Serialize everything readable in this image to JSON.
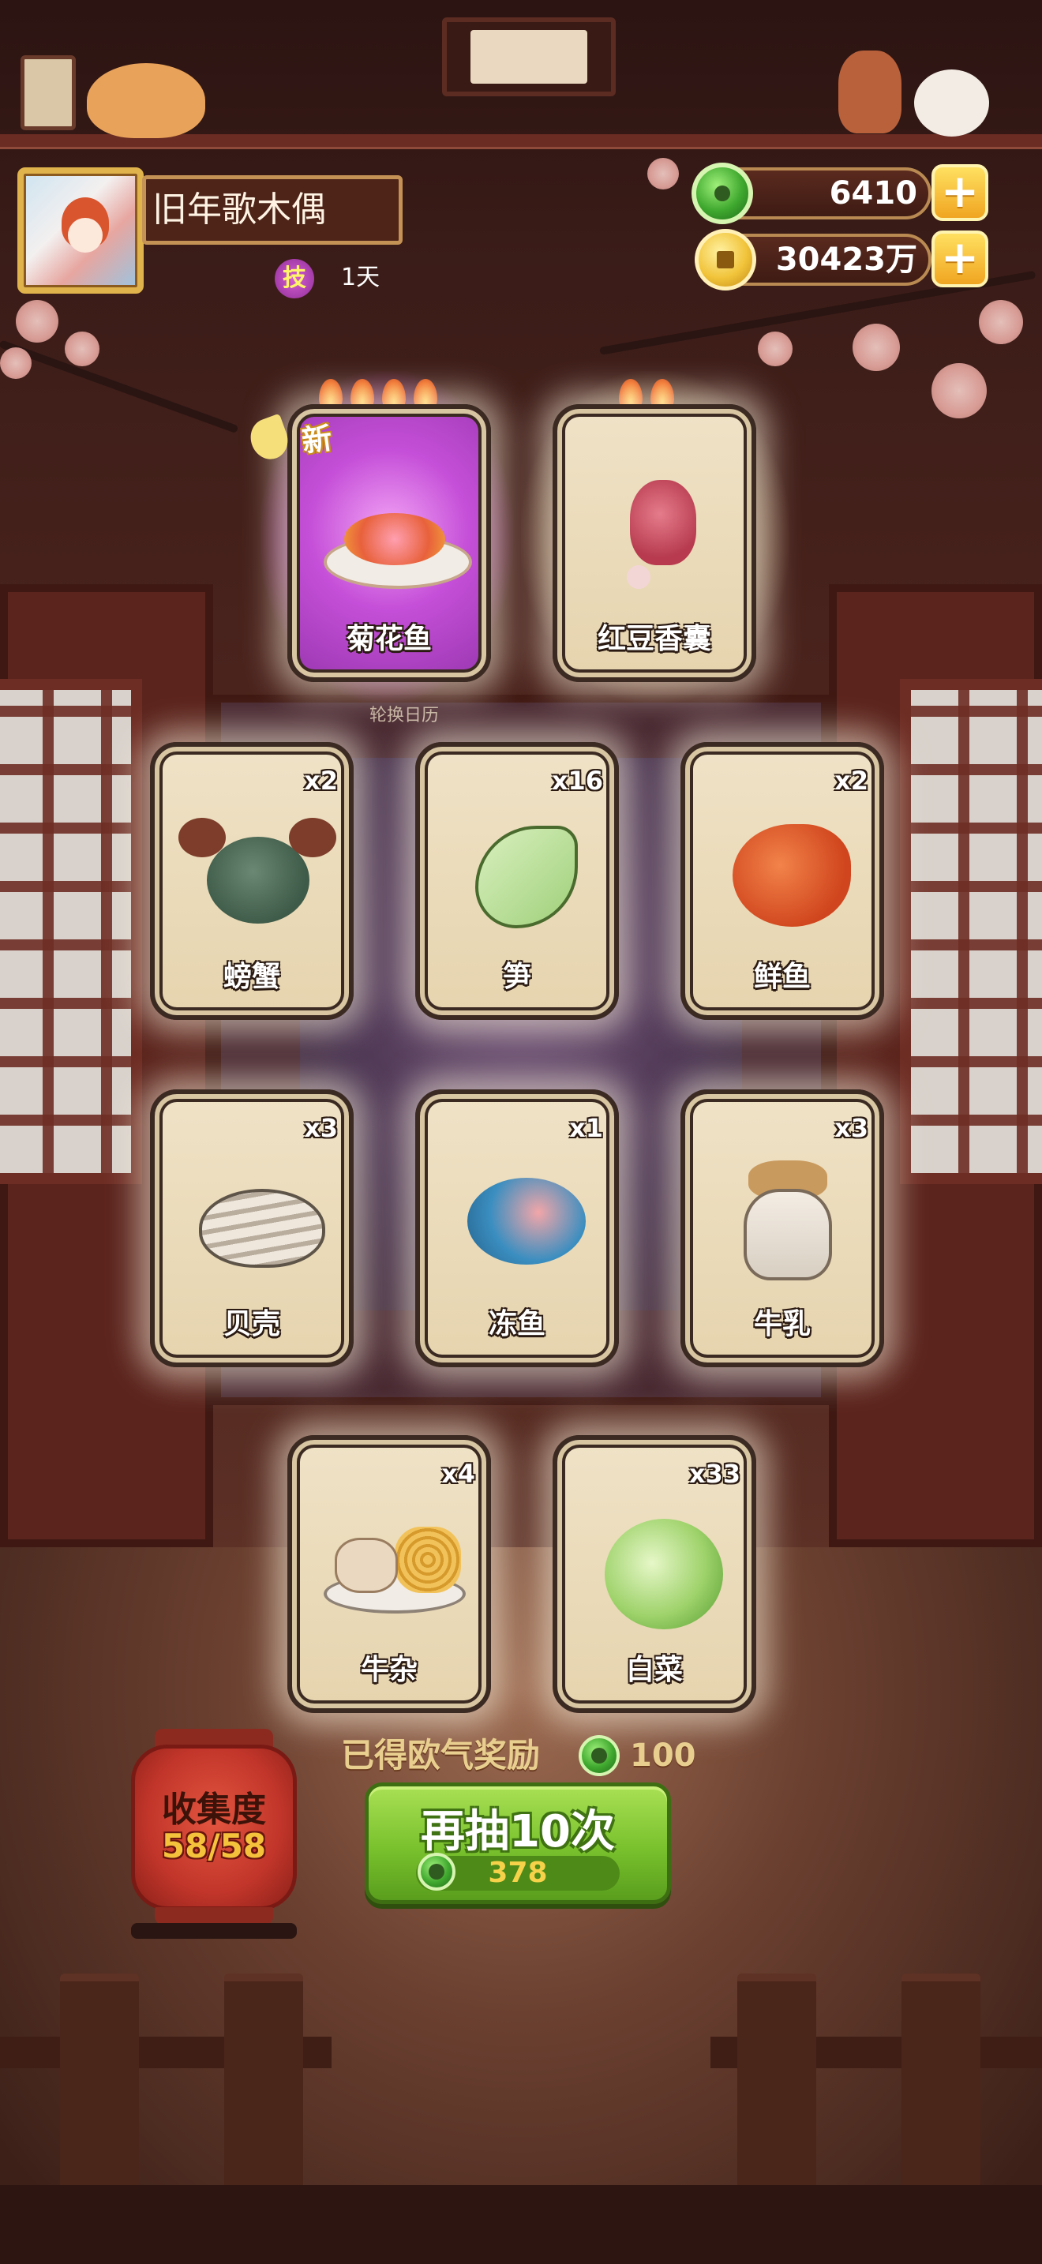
{
  "player": {
    "name": "旧年歌木偶",
    "skill_badge": "技",
    "skill_days": "1天"
  },
  "currency": {
    "jade": "6410",
    "coins": "30423万",
    "jade_icon": "jade-coin-icon",
    "coin_icon": "gold-coin-icon",
    "add_label": "+"
  },
  "featured": [
    {
      "name": "菊花鱼",
      "flames": 4,
      "is_new": true,
      "new_label": "新",
      "art": "chrysanthemum-fish-dish"
    },
    {
      "name": "红豆香囊",
      "flames": 2,
      "is_new": false,
      "art": "red-bean-sachet"
    }
  ],
  "rotate_label": "轮换日历",
  "cards": [
    {
      "name": "螃蟹",
      "count": "x2",
      "art": "crab-icon"
    },
    {
      "name": "笋",
      "count": "x16",
      "art": "bamboo-shoot-icon"
    },
    {
      "name": "鲜鱼",
      "count": "x2",
      "art": "goldfish-icon"
    },
    {
      "name": "贝壳",
      "count": "x3",
      "art": "clam-shell-icon"
    },
    {
      "name": "冻鱼",
      "count": "x1",
      "art": "frozen-fish-icon"
    },
    {
      "name": "牛乳",
      "count": "x3",
      "art": "milk-jar-icon"
    },
    {
      "name": "牛杂",
      "count": "x4",
      "art": "beef-offal-icon"
    },
    {
      "name": "白菜",
      "count": "x33",
      "art": "cabbage-icon"
    }
  ],
  "reward": {
    "label": "已得欧气奖励",
    "amount": "100"
  },
  "collection": {
    "label": "收集度",
    "progress": "58/58"
  },
  "draw_button": {
    "label": "再抽10次",
    "cost": "378"
  },
  "colors": {
    "accent_gold": "#e0b34c",
    "button_green": "#79c12d",
    "lantern_red": "#c1352a",
    "card_glow_purple": "#c23bd8"
  }
}
